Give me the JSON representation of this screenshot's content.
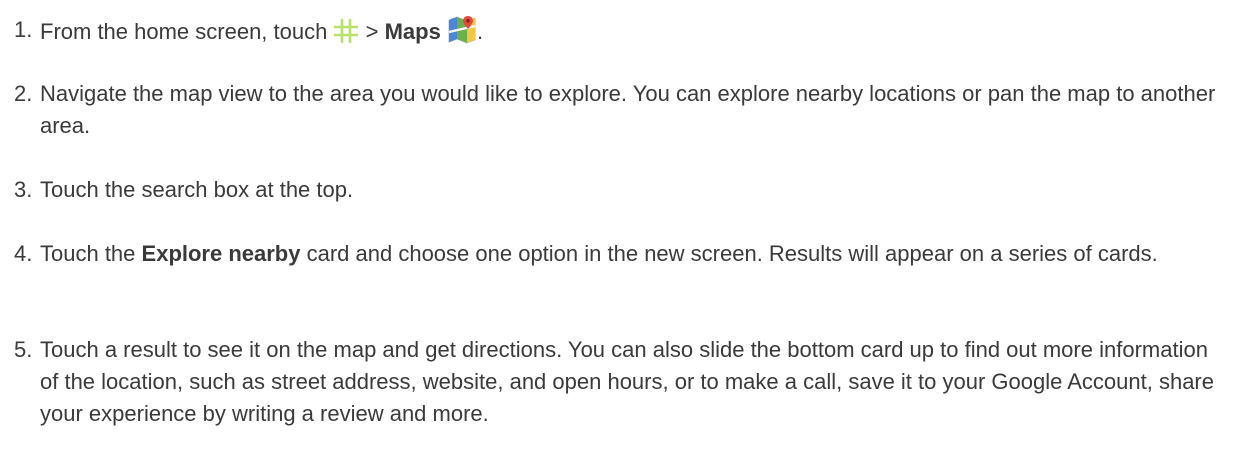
{
  "steps": [
    {
      "number": "1.",
      "before": "From the home screen, touch",
      "apps_icon": "apps-grid-icon",
      "separator": ">",
      "bold": "Maps",
      "maps_icon": "google-maps-icon",
      "after": "."
    },
    {
      "number": "2.",
      "text": "Navigate the map view to the area you would like to explore. You can explore nearby locations or pan the map to another area."
    },
    {
      "number": "3.",
      "text": "Touch the search box at the top."
    },
    {
      "number": "4.",
      "before": "Touch the",
      "bold": "Explore nearby",
      "after": "card and choose one option in the new screen. Results will appear on a series of cards."
    },
    {
      "number": "5.",
      "text": "Touch a result to see it on the map and get directions. You can also slide the bottom card up to find out more information of the location, such as street address, website, and open hours, or to make a call, save it to your Google Account, share your experience by writing a review and more."
    }
  ],
  "colors": {
    "text": "#3a3a3a",
    "apps_icon": "#b8e26a",
    "maps_icon_red": "#e64a3b",
    "maps_icon_blue": "#4a86d9",
    "maps_icon_green": "#6ab04c",
    "maps_icon_yellow": "#f2c744"
  }
}
